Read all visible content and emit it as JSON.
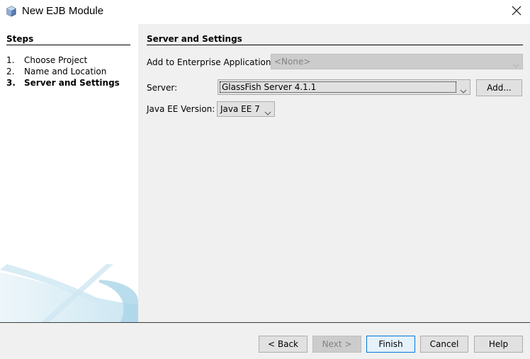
{
  "window": {
    "title": "New EJB Module",
    "icon": "ejb-module-cube-icon",
    "close_icon": "close-icon"
  },
  "steps": {
    "title": "Steps",
    "items": [
      {
        "num": "1.",
        "label": "Choose Project",
        "current": false
      },
      {
        "num": "2.",
        "label": "Name and Location",
        "current": false
      },
      {
        "num": "3.",
        "label": "Server and Settings",
        "current": true
      }
    ]
  },
  "content": {
    "section_title": "Server and Settings",
    "enterprise_app": {
      "label": "Add to Enterprise Application:",
      "value": "<None>",
      "enabled": false
    },
    "server": {
      "label": "Server:",
      "value": "GlassFish Server 4.1.1",
      "add_label": "Add..."
    },
    "java_ee": {
      "label": "Java EE Version:",
      "value": "Java EE 7"
    }
  },
  "footer": {
    "back_label": "< Back",
    "next_label": "Next >",
    "finish_label": "Finish",
    "cancel_label": "Cancel",
    "help_label": "Help"
  },
  "colors": {
    "accent": "#0078d7",
    "panel_bg": "#f0f0f0",
    "button_bg": "#e1e1e1",
    "disabled_bg": "#cccccc"
  }
}
